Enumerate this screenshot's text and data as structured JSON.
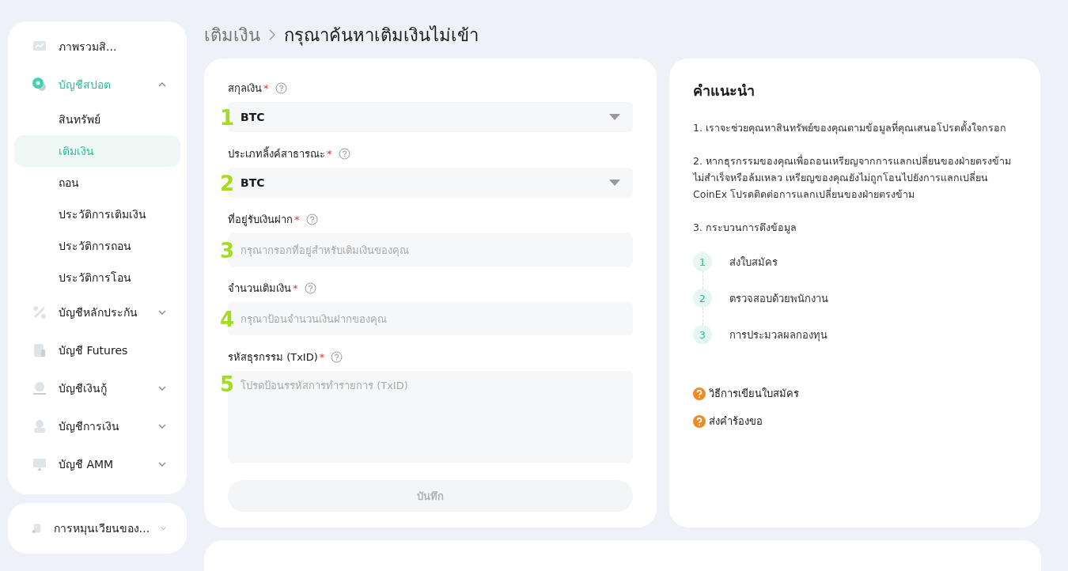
{
  "sidebar": {
    "items": [
      {
        "label": "ภาพรวมสิ..."
      },
      {
        "label": "บัญชีสปอต",
        "expanded": true,
        "children": [
          {
            "label": "สินทรัพย์",
            "selected": false
          },
          {
            "label": "เติมเงิน",
            "selected": true
          },
          {
            "label": "ถอน",
            "selected": false
          },
          {
            "label": "ประวัติการเติมเงิน",
            "selected": false
          },
          {
            "label": "ประวัติการถอน",
            "selected": false
          },
          {
            "label": "ประวัติการโอน",
            "selected": false
          }
        ]
      },
      {
        "label": "บัญชีหลักประกัน",
        "expanded": false
      },
      {
        "label": "บัญชี Futures"
      },
      {
        "label": "บัญชีเงินกู้",
        "expanded": false
      },
      {
        "label": "บัญชีการเงิน",
        "expanded": false
      },
      {
        "label": "บัญชี AMM",
        "expanded": false
      }
    ],
    "extra_items": [
      {
        "label": "การหมุนเวียนของ...",
        "expanded": false
      }
    ]
  },
  "breadcrumb": [
    "เติมเงิน",
    "กรุณาค้นหาเติมเงินไม่เข้า"
  ],
  "form": {
    "fields": [
      {
        "marker": "1",
        "label": "สกุลเงิน",
        "required_mark": "*",
        "kind": "select",
        "value": "BTC"
      },
      {
        "marker": "2",
        "label": "ประเภทลิ้งค์สาธารณะ",
        "required_mark": "*",
        "kind": "select",
        "value": "BTC"
      },
      {
        "marker": "3",
        "label": "ที่อยู่รับเงินฝาก",
        "required_mark": "*",
        "kind": "input",
        "placeholder": "กรุณากรอกที่อยู่สำหรับเติมเงินของคุณ"
      },
      {
        "marker": "4",
        "label": "จำนวนเติมเงิน",
        "required_mark": "*",
        "kind": "input",
        "placeholder": "กรุณาป้อนจำนวนเงินฝากของคุณ"
      },
      {
        "marker": "5",
        "label": "รหัสธุรกรรม (TxID)",
        "required_mark": "*",
        "kind": "textarea",
        "placeholder": "โปรดป้อนรรหัสการทำรายการ (TxID)"
      }
    ],
    "submit": {
      "label": "บันทึก",
      "disabled": true
    }
  },
  "guide": {
    "title": "คำแนะนำ",
    "paragraphs": [
      "1. เราจะช่วยคุณหาสินทรัพย์ของคุณตามข้อมูลที่คุณเสนอโปรดตั้งใจกรอก",
      "2. หากธุรกรรมของคุณเพื่อถอนเหรียญจากการแลกเปลี่ยนของฝ่ายตรงข้ามไม่สำเร็จหรือล้มเหลว เหรียญของคุณยังไม่ถูกโอนไปยังการแลกเปลี่ยน CoinEx โปรดติดต่อการแลกเปลี่ยนของฝ่ายตรงข้าม",
      "3. กระบวนการดึงข้อมูล"
    ],
    "steps": [
      {
        "number": "1",
        "label": "ส่งใบสมัคร"
      },
      {
        "number": "2",
        "label": "ตรวจสอบด้วยพนักงาน"
      },
      {
        "number": "3",
        "label": "การประมวลผลกองทุน"
      }
    ],
    "links": [
      "วิธีการเขียนใบสมัคร",
      "ส่งคำร้องขอ"
    ]
  }
}
